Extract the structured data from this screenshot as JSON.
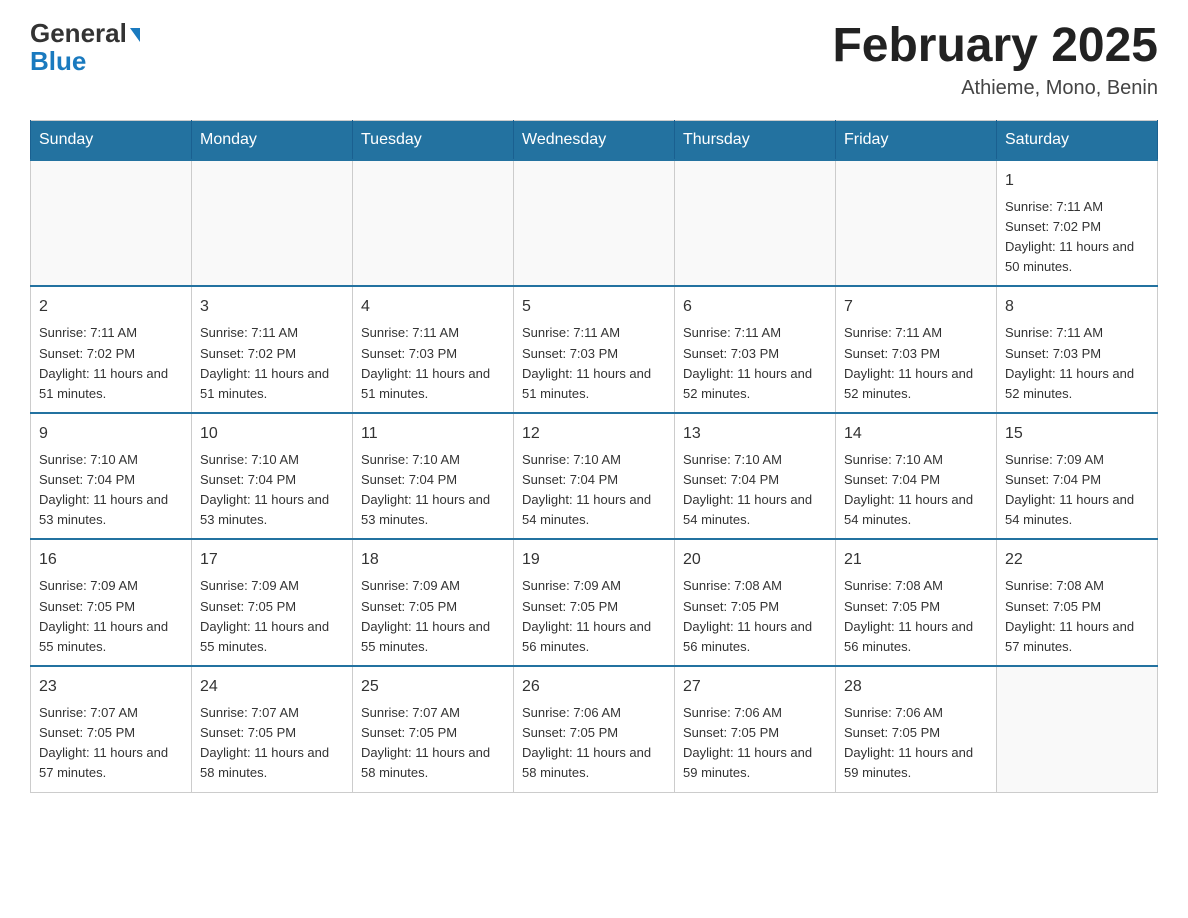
{
  "header": {
    "logo_general": "General",
    "logo_blue": "Blue",
    "month_title": "February 2025",
    "location": "Athieme, Mono, Benin"
  },
  "days_of_week": [
    "Sunday",
    "Monday",
    "Tuesday",
    "Wednesday",
    "Thursday",
    "Friday",
    "Saturday"
  ],
  "weeks": [
    [
      {
        "day": "",
        "info": ""
      },
      {
        "day": "",
        "info": ""
      },
      {
        "day": "",
        "info": ""
      },
      {
        "day": "",
        "info": ""
      },
      {
        "day": "",
        "info": ""
      },
      {
        "day": "",
        "info": ""
      },
      {
        "day": "1",
        "info": "Sunrise: 7:11 AM\nSunset: 7:02 PM\nDaylight: 11 hours and 50 minutes."
      }
    ],
    [
      {
        "day": "2",
        "info": "Sunrise: 7:11 AM\nSunset: 7:02 PM\nDaylight: 11 hours and 51 minutes."
      },
      {
        "day": "3",
        "info": "Sunrise: 7:11 AM\nSunset: 7:02 PM\nDaylight: 11 hours and 51 minutes."
      },
      {
        "day": "4",
        "info": "Sunrise: 7:11 AM\nSunset: 7:03 PM\nDaylight: 11 hours and 51 minutes."
      },
      {
        "day": "5",
        "info": "Sunrise: 7:11 AM\nSunset: 7:03 PM\nDaylight: 11 hours and 51 minutes."
      },
      {
        "day": "6",
        "info": "Sunrise: 7:11 AM\nSunset: 7:03 PM\nDaylight: 11 hours and 52 minutes."
      },
      {
        "day": "7",
        "info": "Sunrise: 7:11 AM\nSunset: 7:03 PM\nDaylight: 11 hours and 52 minutes."
      },
      {
        "day": "8",
        "info": "Sunrise: 7:11 AM\nSunset: 7:03 PM\nDaylight: 11 hours and 52 minutes."
      }
    ],
    [
      {
        "day": "9",
        "info": "Sunrise: 7:10 AM\nSunset: 7:04 PM\nDaylight: 11 hours and 53 minutes."
      },
      {
        "day": "10",
        "info": "Sunrise: 7:10 AM\nSunset: 7:04 PM\nDaylight: 11 hours and 53 minutes."
      },
      {
        "day": "11",
        "info": "Sunrise: 7:10 AM\nSunset: 7:04 PM\nDaylight: 11 hours and 53 minutes."
      },
      {
        "day": "12",
        "info": "Sunrise: 7:10 AM\nSunset: 7:04 PM\nDaylight: 11 hours and 54 minutes."
      },
      {
        "day": "13",
        "info": "Sunrise: 7:10 AM\nSunset: 7:04 PM\nDaylight: 11 hours and 54 minutes."
      },
      {
        "day": "14",
        "info": "Sunrise: 7:10 AM\nSunset: 7:04 PM\nDaylight: 11 hours and 54 minutes."
      },
      {
        "day": "15",
        "info": "Sunrise: 7:09 AM\nSunset: 7:04 PM\nDaylight: 11 hours and 54 minutes."
      }
    ],
    [
      {
        "day": "16",
        "info": "Sunrise: 7:09 AM\nSunset: 7:05 PM\nDaylight: 11 hours and 55 minutes."
      },
      {
        "day": "17",
        "info": "Sunrise: 7:09 AM\nSunset: 7:05 PM\nDaylight: 11 hours and 55 minutes."
      },
      {
        "day": "18",
        "info": "Sunrise: 7:09 AM\nSunset: 7:05 PM\nDaylight: 11 hours and 55 minutes."
      },
      {
        "day": "19",
        "info": "Sunrise: 7:09 AM\nSunset: 7:05 PM\nDaylight: 11 hours and 56 minutes."
      },
      {
        "day": "20",
        "info": "Sunrise: 7:08 AM\nSunset: 7:05 PM\nDaylight: 11 hours and 56 minutes."
      },
      {
        "day": "21",
        "info": "Sunrise: 7:08 AM\nSunset: 7:05 PM\nDaylight: 11 hours and 56 minutes."
      },
      {
        "day": "22",
        "info": "Sunrise: 7:08 AM\nSunset: 7:05 PM\nDaylight: 11 hours and 57 minutes."
      }
    ],
    [
      {
        "day": "23",
        "info": "Sunrise: 7:07 AM\nSunset: 7:05 PM\nDaylight: 11 hours and 57 minutes."
      },
      {
        "day": "24",
        "info": "Sunrise: 7:07 AM\nSunset: 7:05 PM\nDaylight: 11 hours and 58 minutes."
      },
      {
        "day": "25",
        "info": "Sunrise: 7:07 AM\nSunset: 7:05 PM\nDaylight: 11 hours and 58 minutes."
      },
      {
        "day": "26",
        "info": "Sunrise: 7:06 AM\nSunset: 7:05 PM\nDaylight: 11 hours and 58 minutes."
      },
      {
        "day": "27",
        "info": "Sunrise: 7:06 AM\nSunset: 7:05 PM\nDaylight: 11 hours and 59 minutes."
      },
      {
        "day": "28",
        "info": "Sunrise: 7:06 AM\nSunset: 7:05 PM\nDaylight: 11 hours and 59 minutes."
      },
      {
        "day": "",
        "info": ""
      }
    ]
  ]
}
